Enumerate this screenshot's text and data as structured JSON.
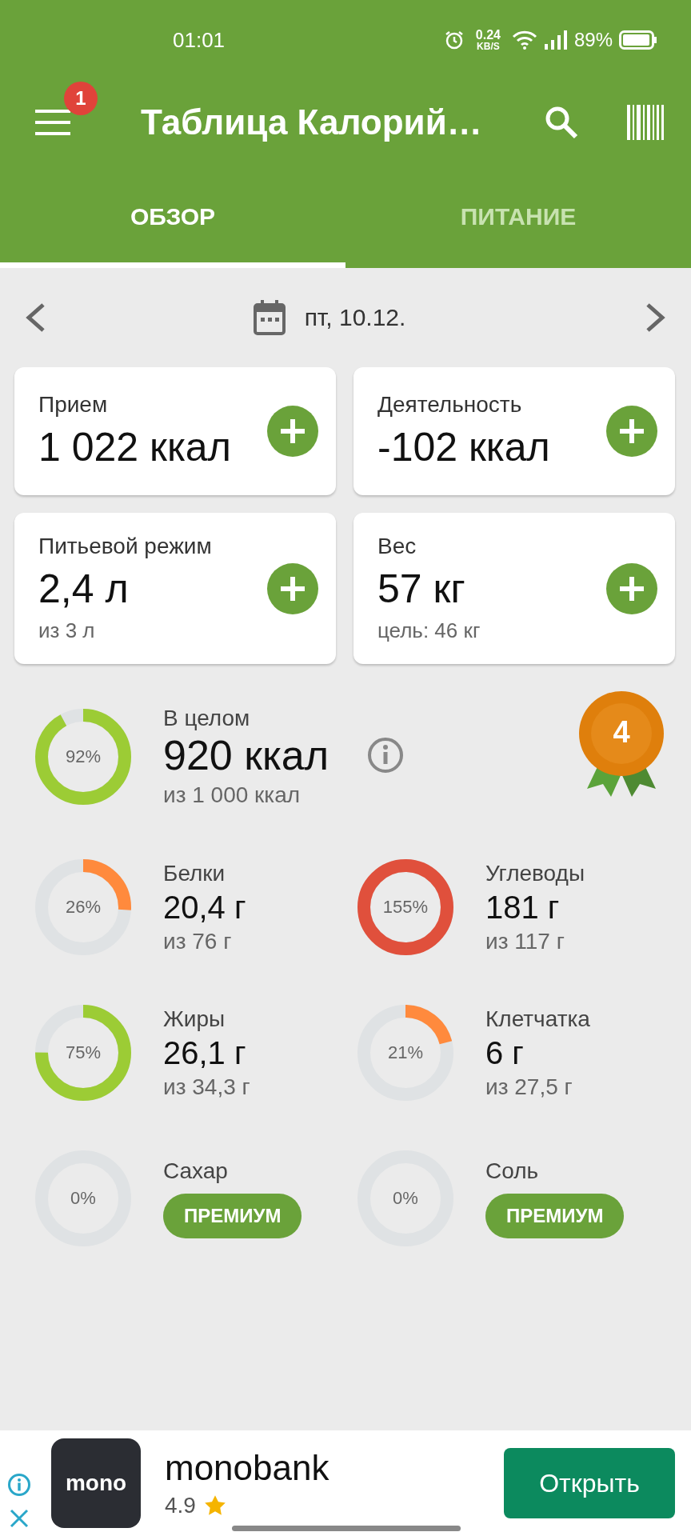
{
  "status_bar": {
    "time": "01:01",
    "speed": "0.24",
    "speed_unit": "KB/S",
    "battery": "89%"
  },
  "app_bar": {
    "title": "Таблица Калорий…",
    "menu_badge": "1"
  },
  "tabs": [
    {
      "label": "ОБЗОР",
      "selected": true
    },
    {
      "label": "ПИТАНИЕ",
      "selected": false
    }
  ],
  "date": "пт, 10.12.",
  "cards": [
    {
      "title": "Прием",
      "value": "1 022 ккал"
    },
    {
      "title": "Деятельность",
      "value": "-102 ккал"
    },
    {
      "title": "Питьевой режим",
      "value": "2,4 л",
      "sub": "из 3 л"
    },
    {
      "title": "Вес",
      "value": "57 кг",
      "sub": "цель: 46 кг"
    }
  ],
  "overall": {
    "label": "В целом",
    "value": "920 ккал",
    "sub": "из 1 000 ккал",
    "percent": "92%",
    "color": "#9ccc35",
    "award": "4"
  },
  "nutrients": [
    {
      "kind": "value",
      "label": "Белки",
      "value": "20,4 г",
      "sub": "из 76 г",
      "percent": "26%",
      "color": "#ff8a3d"
    },
    {
      "kind": "value",
      "label": "Углеводы",
      "value": "181 г",
      "sub": "из 117 г",
      "percent": "155%",
      "color": "#e0503c"
    },
    {
      "kind": "value",
      "label": "Жиры",
      "value": "26,1 г",
      "sub": "из 34,3 г",
      "percent": "75%",
      "color": "#9ccc35"
    },
    {
      "kind": "value",
      "label": "Клетчатка",
      "value": "6 г",
      "sub": "из 27,5 г",
      "percent": "21%",
      "color": "#ff8a3d"
    },
    {
      "kind": "premium",
      "label": "Сахар",
      "button": "ПРЕМИУМ",
      "percent": "0%"
    },
    {
      "kind": "premium",
      "label": "Соль",
      "button": "ПРЕМИУМ",
      "percent": "0%"
    }
  ],
  "ad": {
    "logo": "mono",
    "name": "monobank",
    "rating": "4.9",
    "button": "Открыть"
  }
}
